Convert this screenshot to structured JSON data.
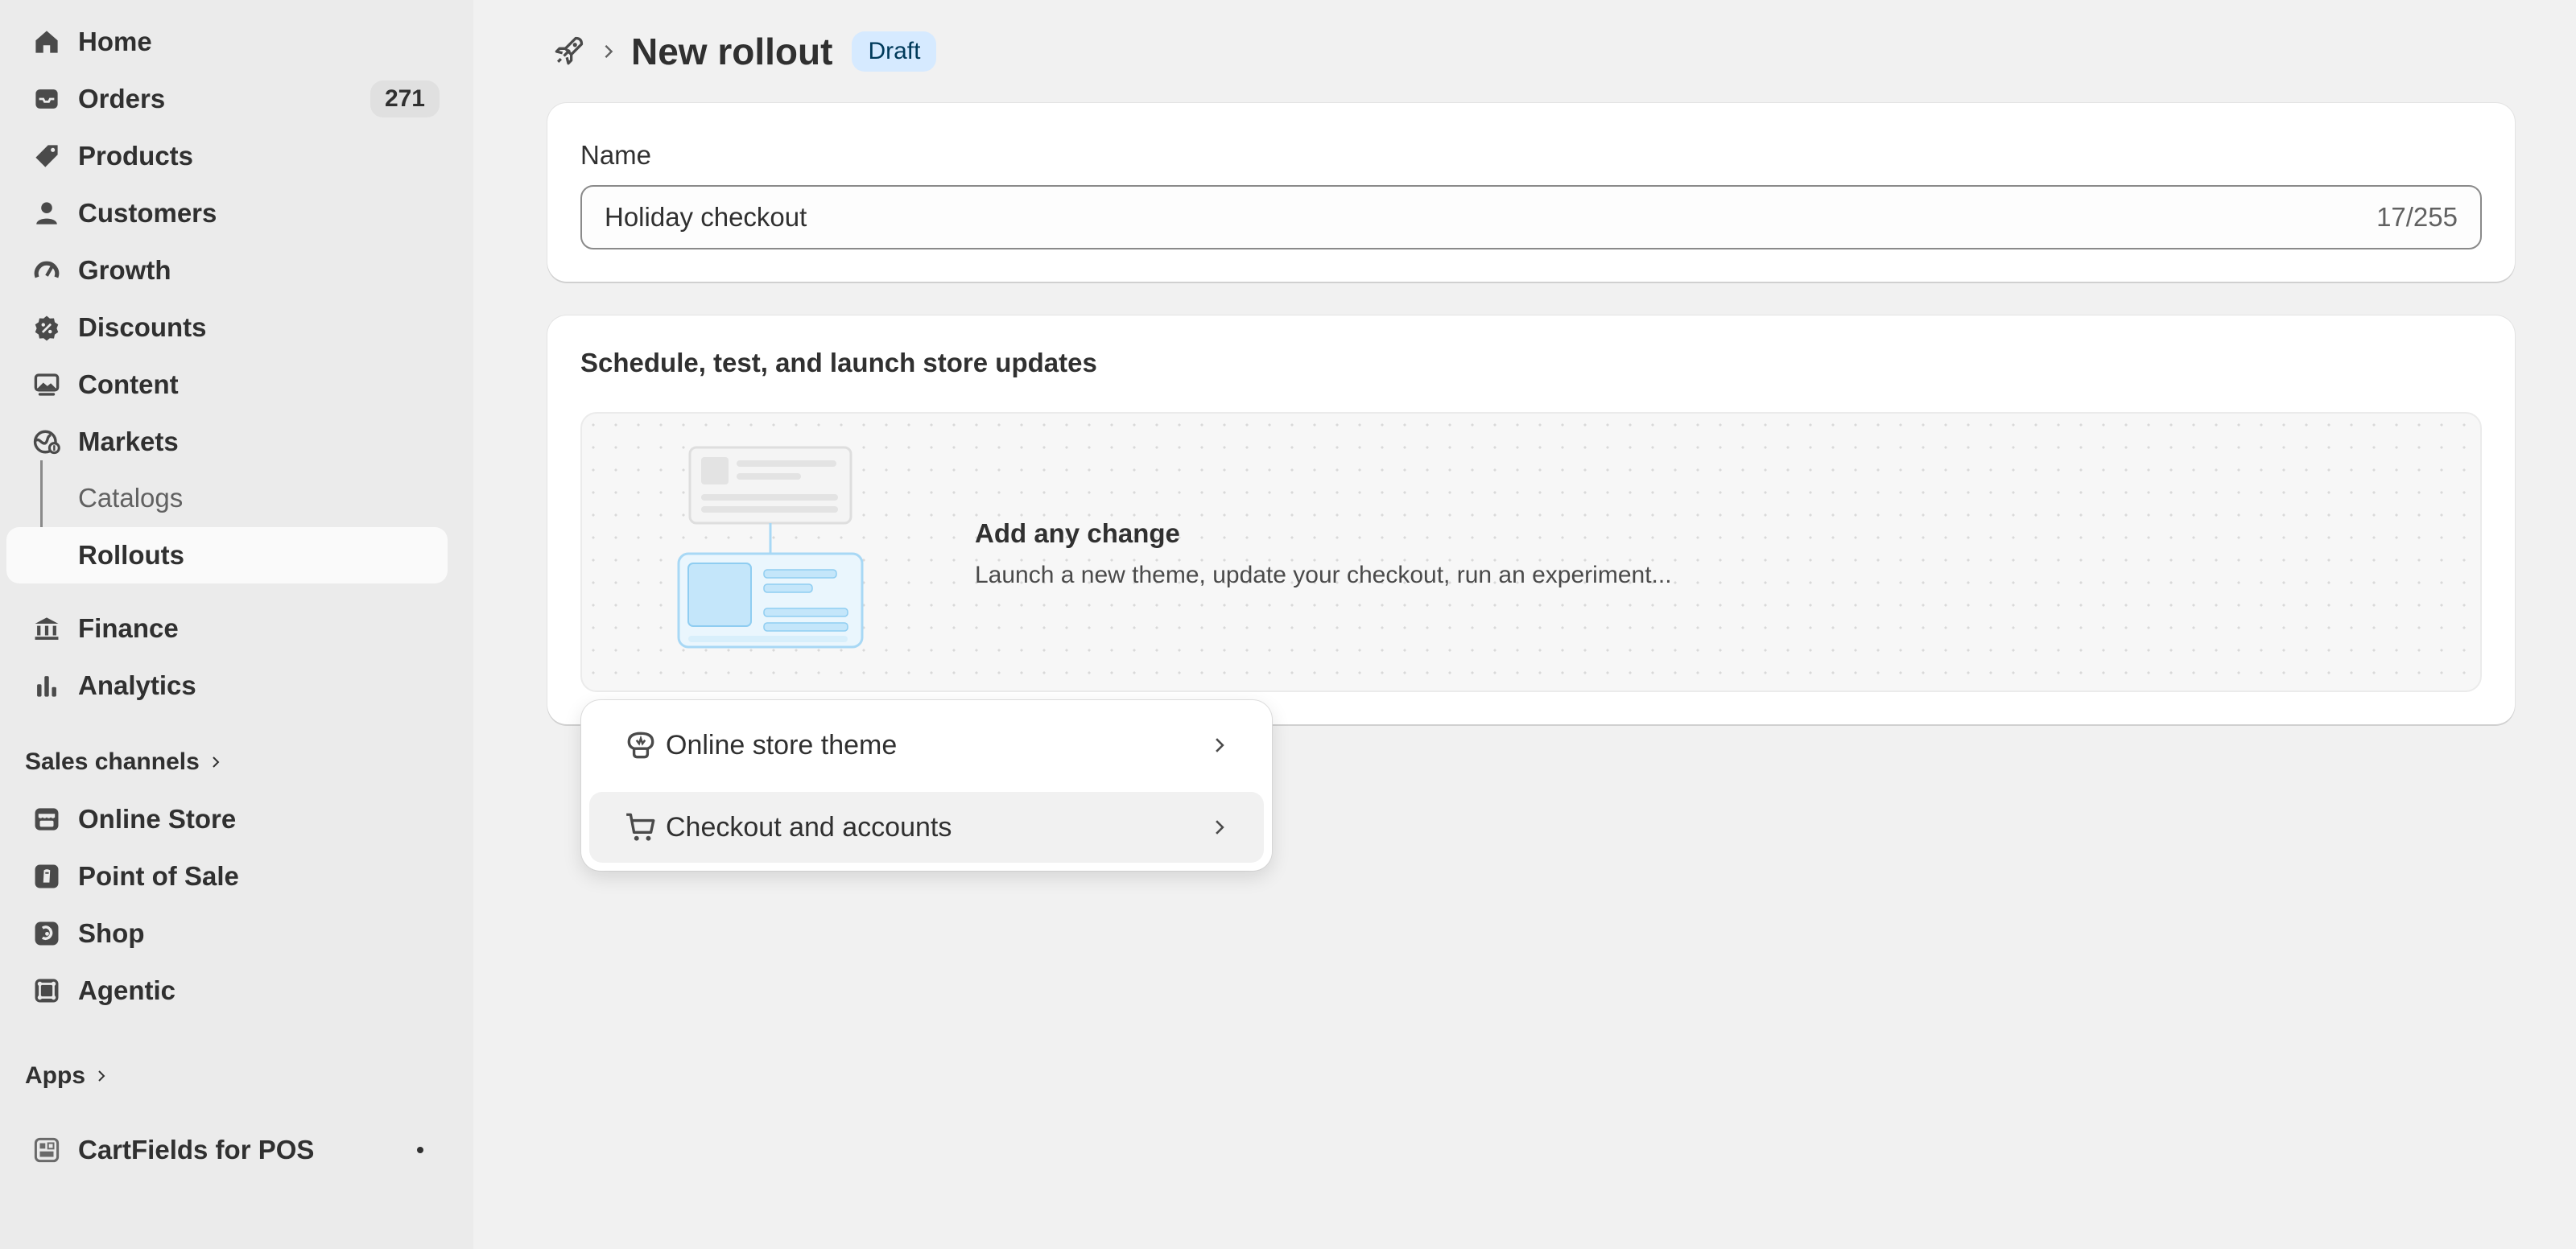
{
  "sidebar": {
    "nav": [
      {
        "label": "Home",
        "icon": "home-icon"
      },
      {
        "label": "Orders",
        "icon": "orders-icon",
        "badge": "271"
      },
      {
        "label": "Products",
        "icon": "tag-icon"
      },
      {
        "label": "Customers",
        "icon": "person-icon"
      },
      {
        "label": "Growth",
        "icon": "gauge-icon"
      },
      {
        "label": "Discounts",
        "icon": "discount-icon"
      },
      {
        "label": "Content",
        "icon": "image-icon"
      },
      {
        "label": "Markets",
        "icon": "globe-icon"
      }
    ],
    "markets_sub": [
      {
        "label": "Catalogs"
      },
      {
        "label": "Rollouts",
        "active": true
      }
    ],
    "nav2": [
      {
        "label": "Finance",
        "icon": "bank-icon"
      },
      {
        "label": "Analytics",
        "icon": "bar-chart-icon"
      }
    ],
    "sales_channels_header": "Sales channels",
    "sales_channels": [
      {
        "label": "Online Store",
        "icon": "store-icon"
      },
      {
        "label": "Point of Sale",
        "icon": "pos-icon"
      },
      {
        "label": "Shop",
        "icon": "shop-icon"
      },
      {
        "label": "Agentic",
        "icon": "agentic-icon"
      }
    ],
    "apps_header": "Apps",
    "apps": [
      {
        "label": "CartFields for POS",
        "icon": "app-icon"
      }
    ]
  },
  "header": {
    "title": "New rollout",
    "status": "Draft"
  },
  "name_card": {
    "label": "Name",
    "value": "Holiday checkout",
    "char_count": "17/255"
  },
  "schedule_card": {
    "heading": "Schedule, test, and launch store updates",
    "empty_title": "Add any change",
    "empty_description": "Launch a new theme, update your checkout, run an experiment..."
  },
  "popover": {
    "items": [
      {
        "label": "Online store theme",
        "icon": "theme-icon"
      },
      {
        "label": "Checkout and accounts",
        "icon": "cart-icon"
      }
    ]
  },
  "colors": {
    "sidebar_bg": "#ebebeb",
    "page_bg": "#f1f1f1",
    "badge_bg": "#d6eaff",
    "text": "#303030"
  }
}
